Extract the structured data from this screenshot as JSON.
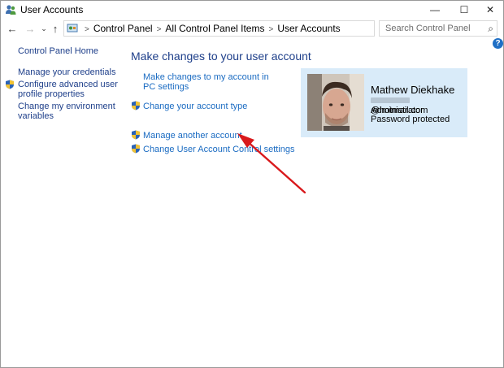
{
  "window": {
    "title": "User Accounts",
    "controls": {
      "minimize": "—",
      "maximize": "☐",
      "close": "✕"
    }
  },
  "nav": {
    "back": "←",
    "forward": "→",
    "recent": "⌄",
    "up": "↑"
  },
  "address": {
    "breadcrumbs": [
      "Control Panel",
      "All Control Panel Items",
      "User Accounts"
    ],
    "separator": ">",
    "dropdown": "⌄",
    "refresh": "↻"
  },
  "search": {
    "placeholder": "Search Control Panel",
    "icon": "⌕"
  },
  "help": {
    "label": "?"
  },
  "sidebar": {
    "items": [
      {
        "label": "Control Panel Home",
        "shield": false
      },
      {
        "label": "Manage your credentials",
        "shield": false
      },
      {
        "label": "Configure advanced user profile properties",
        "shield": true
      },
      {
        "label": "Change my environment variables",
        "shield": false
      }
    ]
  },
  "main": {
    "title": "Make changes to your user account",
    "tasks": [
      {
        "label": "Make changes to my account in PC settings",
        "shield": false
      },
      {
        "label": "Change your account type",
        "shield": true
      },
      {
        "label": "Manage another account",
        "shield": true
      },
      {
        "label": "Change User Account Control settings",
        "shield": true
      }
    ]
  },
  "account": {
    "name": "Mathew Diekhake",
    "email_suffix": "@hotmail.com",
    "type": "Administrator",
    "password_status": "Password protected"
  },
  "colors": {
    "link": "#1a6bc2",
    "heading": "#1e3f8a",
    "card_bg": "#d9ebf9",
    "annotation_arrow": "#d9191c"
  }
}
